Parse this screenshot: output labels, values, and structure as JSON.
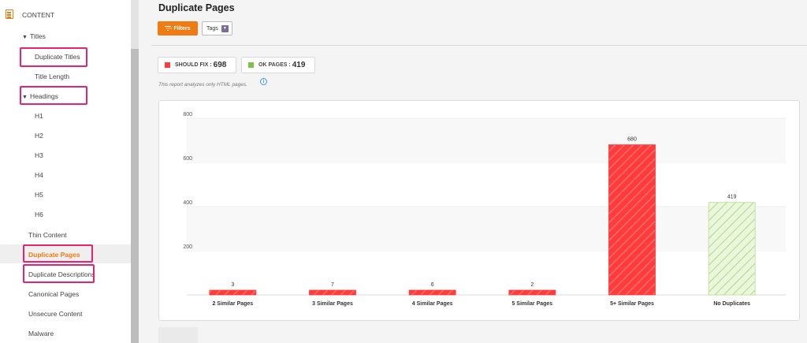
{
  "sidebar": {
    "section_label": "CONTENT",
    "groups": [
      {
        "key": "titles",
        "label": "Titles"
      },
      {
        "key": "headings",
        "label": "Headings"
      }
    ],
    "items": [
      {
        "key": "duplicate-titles",
        "label": "Duplicate Titles"
      },
      {
        "key": "title-length",
        "label": "Title Length"
      },
      {
        "key": "h1",
        "label": "H1"
      },
      {
        "key": "h2",
        "label": "H2"
      },
      {
        "key": "h3",
        "label": "H3"
      },
      {
        "key": "h4",
        "label": "H4"
      },
      {
        "key": "h5",
        "label": "H5"
      },
      {
        "key": "h6",
        "label": "H6"
      },
      {
        "key": "thin-content",
        "label": "Thin Content"
      },
      {
        "key": "duplicate-pages",
        "label": "Duplicate Pages"
      },
      {
        "key": "duplicate-descriptions",
        "label": "Duplicate Descriptions"
      },
      {
        "key": "canonical-pages",
        "label": "Canonical Pages"
      },
      {
        "key": "unsecure-content",
        "label": "Unsecure Content"
      },
      {
        "key": "malware",
        "label": "Malware"
      }
    ],
    "active_item": "duplicate-pages"
  },
  "main": {
    "title": "Duplicate Pages",
    "filters_label": "Filters",
    "tags_label": "Tags",
    "stats": {
      "should_fix_label": "SHOULD FIX :",
      "should_fix_value": "698",
      "ok_pages_label": "OK PAGES :",
      "ok_pages_value": "419"
    },
    "note": "This report analyzes only HTML pages."
  },
  "colors": {
    "accent": "#f07b12",
    "should_fix": "#ff3b3b",
    "ok": "#7cc243",
    "highlight": "#e8226f"
  },
  "icons": {
    "section": "document-icon",
    "filters": "filter-icon",
    "tags_caret": "caret-down-icon",
    "info": "info-icon"
  },
  "chart_data": {
    "type": "bar",
    "categories": [
      "2 Similar Pages",
      "3 Similar Pages",
      "4 Similar Pages",
      "5 Similar Pages",
      "5+ Similar Pages",
      "No Duplicates"
    ],
    "values": [
      3,
      7,
      6,
      2,
      680,
      419
    ],
    "status": [
      "should_fix",
      "should_fix",
      "should_fix",
      "should_fix",
      "should_fix",
      "ok"
    ],
    "data_labels": [
      "3",
      "7",
      "6",
      "2",
      "680",
      "419"
    ],
    "y_ticks": [
      200,
      400,
      600,
      800
    ],
    "ylim": [
      0,
      800
    ],
    "ylabel": "",
    "grid": true
  }
}
